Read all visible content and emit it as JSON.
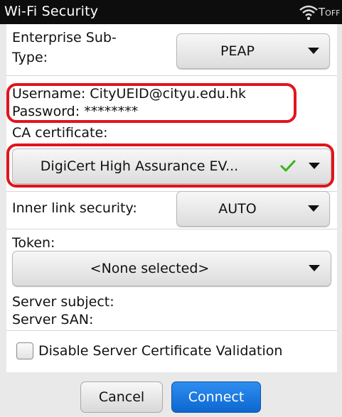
{
  "statusbar": {
    "title": "Wi-Fi Security",
    "signal_label": "T",
    "signal_sub": "OFF"
  },
  "form": {
    "enterprise_subtype_label_1": "Enterprise Sub-",
    "enterprise_subtype_label_2": "Type:",
    "enterprise_subtype_value": "PEAP",
    "username_label": "Username: CityUEID@cityu.edu.hk",
    "password_label": "Password: ********",
    "ca_certificate_label": "CA certificate:",
    "ca_certificate_value": "DigiCert High Assurance EV...",
    "inner_link_label": "Inner link security:",
    "inner_link_value": "AUTO",
    "token_label": "Token:",
    "token_value": "<None selected>",
    "server_subject_label": "Server subject:",
    "server_san_label": "Server SAN:",
    "disable_validation_label": "Disable Server Certificate Validation"
  },
  "buttons": {
    "cancel": "Cancel",
    "connect": "Connect"
  },
  "colors": {
    "highlight": "#e1141c",
    "accent": "#1a78e0",
    "check": "#39b31f"
  },
  "icons": {
    "wifi": "wifi-icon",
    "check": "check-icon",
    "caret": "chevron-down-icon"
  }
}
